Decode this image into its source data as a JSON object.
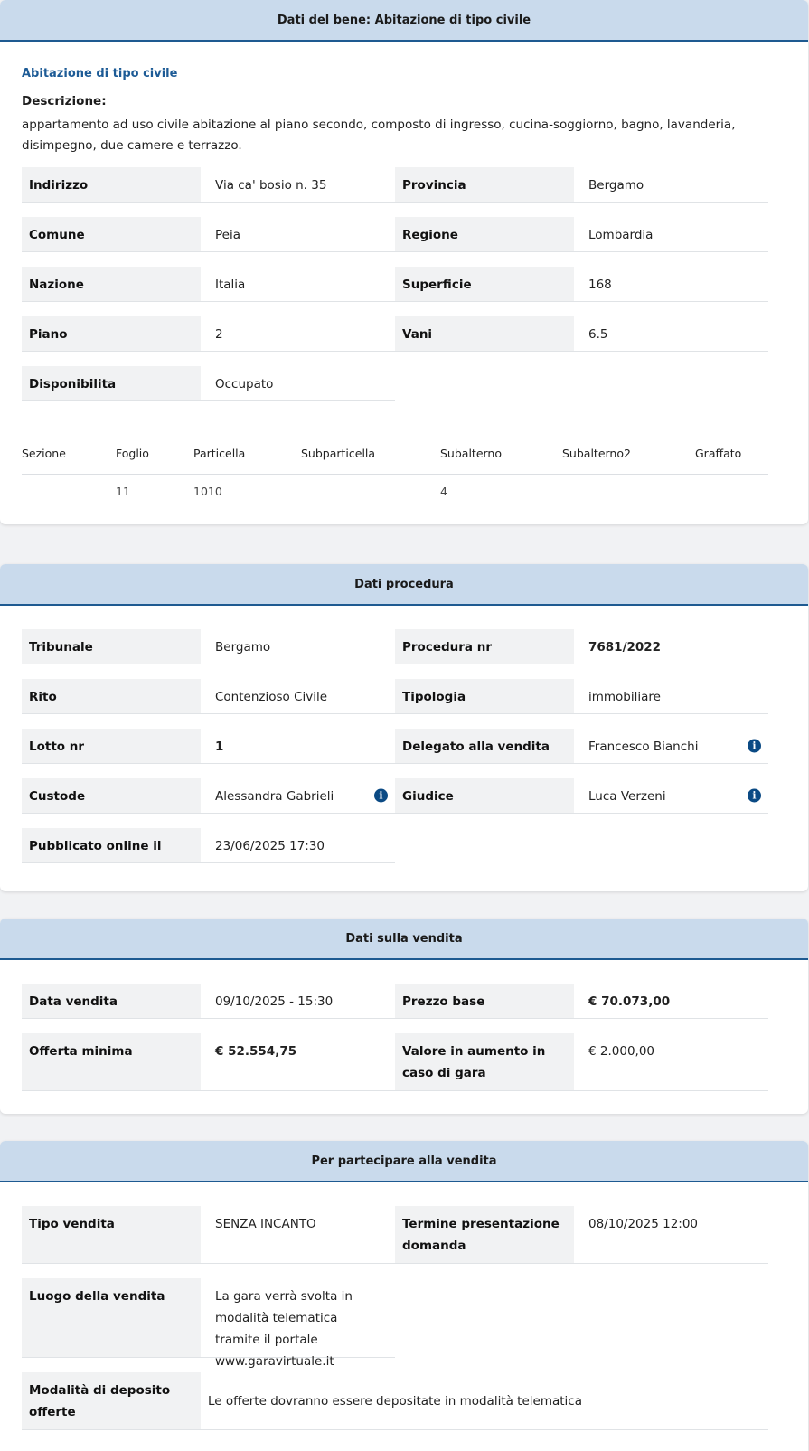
{
  "bene": {
    "header": "Dati del bene: Abitazione di tipo civile",
    "subtitle": "Abitazione di tipo civile",
    "descrizione_label": "Descrizione:",
    "descrizione": "appartamento ad uso civile abitazione al piano secondo, composto di ingresso, cucina-soggiorno, bagno, lavanderia, disimpegno, due camere e terrazzo.",
    "fields": {
      "indirizzo": {
        "label": "Indirizzo",
        "value": "Via ca' bosio n. 35"
      },
      "provincia": {
        "label": "Provincia",
        "value": "Bergamo"
      },
      "comune": {
        "label": "Comune",
        "value": "Peia"
      },
      "regione": {
        "label": "Regione",
        "value": "Lombardia"
      },
      "nazione": {
        "label": "Nazione",
        "value": "Italia"
      },
      "superficie": {
        "label": "Superficie",
        "value": "168"
      },
      "piano": {
        "label": "Piano",
        "value": "2"
      },
      "vani": {
        "label": "Vani",
        "value": "6.5"
      },
      "disponibilita": {
        "label": "Disponibilita",
        "value": "Occupato"
      }
    },
    "catasto": {
      "headers": [
        "Sezione",
        "Foglio",
        "Particella",
        "Subparticella",
        "Subalterno",
        "Subalterno2",
        "Graffato"
      ],
      "row": [
        "",
        "11",
        "1010",
        "",
        "4",
        "",
        ""
      ]
    }
  },
  "procedura": {
    "header": "Dati procedura",
    "fields": {
      "tribunale": {
        "label": "Tribunale",
        "value": "Bergamo"
      },
      "procedura_nr": {
        "label": "Procedura nr",
        "value": "7681/2022"
      },
      "rito": {
        "label": "Rito",
        "value": "Contenzioso Civile"
      },
      "tipologia": {
        "label": "Tipologia",
        "value": "immobiliare"
      },
      "lotto_nr": {
        "label": "Lotto nr",
        "value": "1"
      },
      "delegato": {
        "label": "Delegato alla vendita",
        "value": "Francesco Bianchi"
      },
      "custode": {
        "label": "Custode",
        "value": "Alessandra Gabrieli"
      },
      "giudice": {
        "label": "Giudice",
        "value": "Luca Verzeni"
      },
      "pubblicato": {
        "label": "Pubblicato online il",
        "value": "23/06/2025 17:30"
      }
    },
    "info_icon": "info-icon",
    "info_glyph": "i"
  },
  "vendita": {
    "header": "Dati sulla vendita",
    "fields": {
      "data_vendita": {
        "label": "Data vendita",
        "value": "09/10/2025 - 15:30"
      },
      "prezzo_base": {
        "label": "Prezzo base",
        "value": "€ 70.073,00"
      },
      "offerta_minima": {
        "label": "Offerta minima",
        "value": "€ 52.554,75"
      },
      "valore_aumento": {
        "label": "Valore in aumento in caso di gara",
        "value": "€ 2.000,00"
      }
    }
  },
  "partecipare": {
    "header": "Per partecipare alla vendita",
    "fields": {
      "tipo_vendita": {
        "label": "Tipo vendita",
        "value": "SENZA INCANTO"
      },
      "termine": {
        "label": "Termine presentazione domanda",
        "value": "08/10/2025 12:00"
      },
      "luogo": {
        "label": "Luogo della vendita",
        "value": "La gara verrà svolta in modalità telematica tramite il portale www.garavirtuale.it"
      },
      "modalita": {
        "label": "Modalità di deposito offerte",
        "value": "Le offerte dovranno essere depositate in modalità telematica"
      }
    }
  },
  "colors": {
    "header_bg": "#c9daec",
    "header_border": "#1e5a91",
    "subtitle": "#1d5b96",
    "info_icon": "#0b4a84",
    "label_bg": "#f1f2f3",
    "page_bg": "#f1f2f4"
  }
}
